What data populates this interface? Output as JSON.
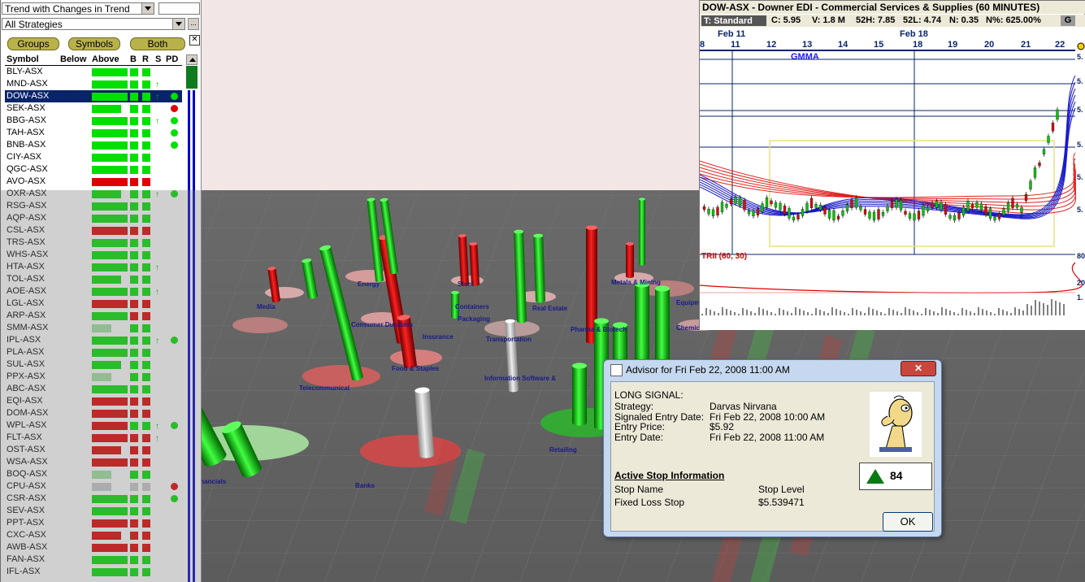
{
  "left_panel": {
    "filter_select": "Trend with Changes in Trend",
    "filter_value": "",
    "strategy_select": "All Strategies",
    "buttons": {
      "groups": "Groups",
      "symbols": "Symbols",
      "both": "Both"
    },
    "columns": {
      "symbol": "Symbol",
      "below": "Below",
      "above": "Above",
      "b": "B",
      "r": "R",
      "s": "S",
      "pd": "PD"
    },
    "rows": [
      {
        "symbol": "BLY-ASX",
        "bar": "green",
        "b": "green",
        "r": "green",
        "s": "",
        "pd": ""
      },
      {
        "symbol": "MND-ASX",
        "bar": "green",
        "b": "green",
        "r": "green",
        "s": "↑",
        "pd": ""
      },
      {
        "symbol": "DOW-ASX",
        "bar": "green",
        "b": "green",
        "r": "green",
        "s": "↑",
        "pd": "green"
      },
      {
        "symbol": "SEK-ASX",
        "bar": "green",
        "b": "green",
        "r": "green",
        "s": "",
        "pd": "red"
      },
      {
        "symbol": "BBG-ASX",
        "bar": "green",
        "b": "green",
        "r": "green",
        "s": "↑",
        "pd": "green"
      },
      {
        "symbol": "TAH-ASX",
        "bar": "green",
        "b": "green",
        "r": "green",
        "s": "",
        "pd": "green"
      },
      {
        "symbol": "BNB-ASX",
        "bar": "green",
        "b": "green",
        "r": "green",
        "s": "",
        "pd": "green"
      },
      {
        "symbol": "CIY-ASX",
        "bar": "green",
        "b": "green",
        "r": "green",
        "s": "",
        "pd": ""
      },
      {
        "symbol": "QGC-ASX",
        "bar": "green",
        "b": "green",
        "r": "green",
        "s": "",
        "pd": ""
      },
      {
        "symbol": "AVO-ASX",
        "bar": "red",
        "b": "red",
        "r": "red",
        "s": "",
        "pd": ""
      },
      {
        "symbol": "OXR-ASX",
        "bar": "green",
        "b": "green",
        "r": "green",
        "s": "↑",
        "pd": "green"
      },
      {
        "symbol": "RSG-ASX",
        "bar": "green",
        "b": "green",
        "r": "green",
        "s": "",
        "pd": ""
      },
      {
        "symbol": "AQP-ASX",
        "bar": "green",
        "b": "green",
        "r": "green",
        "s": "",
        "pd": ""
      },
      {
        "symbol": "CSL-ASX",
        "bar": "red",
        "b": "red",
        "r": "red",
        "s": "",
        "pd": ""
      },
      {
        "symbol": "TRS-ASX",
        "bar": "green",
        "b": "green",
        "r": "green",
        "s": "",
        "pd": ""
      },
      {
        "symbol": "WHS-ASX",
        "bar": "green",
        "b": "green",
        "r": "green",
        "s": "",
        "pd": ""
      },
      {
        "symbol": "HTA-ASX",
        "bar": "green",
        "b": "green",
        "r": "green",
        "s": "↑",
        "pd": ""
      },
      {
        "symbol": "TOL-ASX",
        "bar": "green",
        "b": "green",
        "r": "green",
        "s": "",
        "pd": ""
      },
      {
        "symbol": "AOE-ASX",
        "bar": "green",
        "b": "green",
        "r": "green",
        "s": "↑",
        "pd": ""
      },
      {
        "symbol": "LGL-ASX",
        "bar": "red",
        "b": "red",
        "r": "red",
        "s": "",
        "pd": ""
      },
      {
        "symbol": "ARP-ASX",
        "bar": "green",
        "b": "red",
        "r": "red",
        "s": "",
        "pd": ""
      },
      {
        "symbol": "SMM-ASX",
        "bar": "lightgreen",
        "b": "green",
        "r": "green",
        "s": "",
        "pd": ""
      },
      {
        "symbol": "IPL-ASX",
        "bar": "green",
        "b": "green",
        "r": "green",
        "s": "↑",
        "pd": "green"
      },
      {
        "symbol": "PLA-ASX",
        "bar": "green",
        "b": "green",
        "r": "green",
        "s": "",
        "pd": ""
      },
      {
        "symbol": "SUL-ASX",
        "bar": "green",
        "b": "green",
        "r": "green",
        "s": "",
        "pd": ""
      },
      {
        "symbol": "PPX-ASX",
        "bar": "lightgreen",
        "b": "green",
        "r": "green",
        "s": "",
        "pd": ""
      },
      {
        "symbol": "ABC-ASX",
        "bar": "green",
        "b": "green",
        "r": "green",
        "s": "",
        "pd": ""
      },
      {
        "symbol": "EQI-ASX",
        "bar": "red",
        "b": "red",
        "r": "red",
        "s": "",
        "pd": ""
      },
      {
        "symbol": "DOM-ASX",
        "bar": "red",
        "b": "red",
        "r": "red",
        "s": "",
        "pd": ""
      },
      {
        "symbol": "WPL-ASX",
        "bar": "red",
        "b": "green",
        "r": "green",
        "s": "↑",
        "pd": "green"
      },
      {
        "symbol": "FLT-ASX",
        "bar": "red",
        "b": "red",
        "r": "red",
        "s": "↑",
        "pd": ""
      },
      {
        "symbol": "OST-ASX",
        "bar": "red",
        "b": "red",
        "r": "red",
        "s": "",
        "pd": ""
      },
      {
        "symbol": "WSA-ASX",
        "bar": "red",
        "b": "red",
        "r": "red",
        "s": "",
        "pd": ""
      },
      {
        "symbol": "BOQ-ASX",
        "bar": "lightgreen",
        "b": "green",
        "r": "green",
        "s": "",
        "pd": ""
      },
      {
        "symbol": "CPU-ASX",
        "bar": "gray",
        "b": "gray",
        "r": "gray",
        "s": "",
        "pd": "red"
      },
      {
        "symbol": "CSR-ASX",
        "bar": "green",
        "b": "green",
        "r": "green",
        "s": "",
        "pd": "green"
      },
      {
        "symbol": "SEV-ASX",
        "bar": "green",
        "b": "green",
        "r": "green",
        "s": "",
        "pd": ""
      },
      {
        "symbol": "PPT-ASX",
        "bar": "red",
        "b": "red",
        "r": "red",
        "s": "",
        "pd": ""
      },
      {
        "symbol": "CXC-ASX",
        "bar": "red",
        "b": "red",
        "r": "red",
        "s": "",
        "pd": ""
      },
      {
        "symbol": "AWB-ASX",
        "bar": "red",
        "b": "red",
        "r": "red",
        "s": "",
        "pd": ""
      },
      {
        "symbol": "FAN-ASX",
        "bar": "green",
        "b": "green",
        "r": "green",
        "s": "",
        "pd": ""
      },
      {
        "symbol": "IFL-ASX",
        "bar": "green",
        "b": "green",
        "r": "green",
        "s": "",
        "pd": ""
      }
    ],
    "selected_index": 2
  },
  "scene_labels": [
    "Media",
    "Energy",
    "Consumer Durables",
    "Food & Staples",
    "Telecommunical",
    "Insurance",
    "Steel",
    "Containers",
    "Packaging",
    "Transportation",
    "Information Software &",
    "Metals & Mining",
    "Real Estate",
    "Pharma & Biotech",
    "Retailing",
    "Chemicals",
    "Equipment",
    "Banks",
    "Diversified Financials"
  ],
  "chart": {
    "title": "DOW-ASX - Downer EDI - Commercial Services & Supplies (60 MINUTES)",
    "template": "T: Standard",
    "close": "C: 5.95",
    "volume": "V: 1.8 M",
    "high52": "52H: 7.85",
    "low52": "52L: 4.74",
    "n": "N: 0.35",
    "npct": "N%: 625.00%",
    "g_button": "G",
    "month_labels": [
      "Feb 11",
      "Feb 18"
    ],
    "day_labels": [
      "8",
      "11",
      "12",
      "13",
      "14",
      "15",
      "18",
      "19",
      "20",
      "21",
      "22"
    ],
    "indicator_label": "GMMA",
    "sub_indicator": "TRII (60, 30)",
    "right_axis": [
      "5.",
      "5.",
      "5.",
      "5.",
      "5.",
      "5.",
      "80",
      "20",
      "1."
    ]
  },
  "advisor": {
    "title": "Advisor for Fri Feb 22, 2008 11:00 AM",
    "close_label": "✕",
    "signal": "LONG SIGNAL:",
    "fields": [
      {
        "label": "Strategy:",
        "value": "Darvas Nirvana"
      },
      {
        "label": "Signaled Entry Date:",
        "value": "Fri Feb 22, 2008 10:00 AM"
      },
      {
        "label": "Entry Price:",
        "value": "$5.92"
      },
      {
        "label": "Entry Date:",
        "value": "Fri Feb 22, 2008 11:00 AM"
      }
    ],
    "stop_heading": "Active Stop Information",
    "stop_col1": "Stop Name",
    "stop_col2": "Stop Level",
    "stop_name": "Fixed Loss Stop",
    "stop_level": "$5.539471",
    "score": "84",
    "ok": "OK"
  },
  "colors": {
    "green": "#00e000",
    "red": "#e00000",
    "lightgreen": "#a0e0a0",
    "gray": "#c8c8c8",
    "selected": "#0a246a"
  }
}
